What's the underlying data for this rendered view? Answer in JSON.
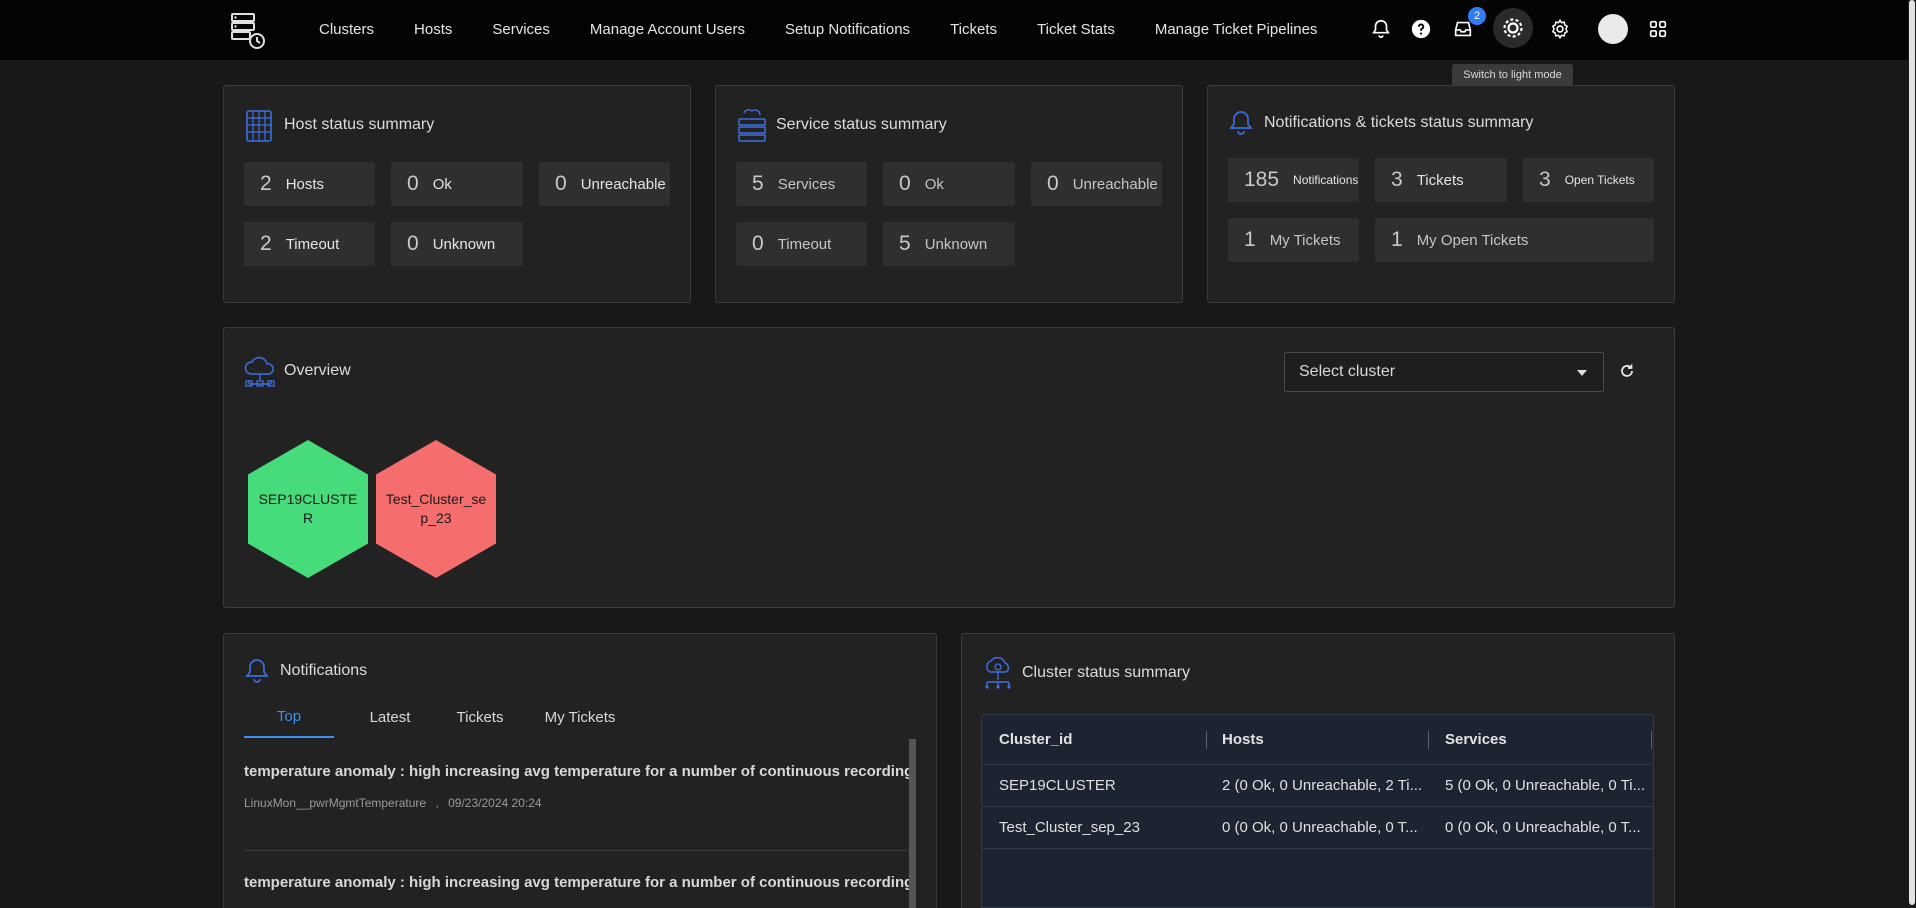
{
  "nav": {
    "items": [
      "Clusters",
      "Hosts",
      "Services",
      "Manage Account Users",
      "Setup Notifications",
      "Tickets",
      "Ticket Stats",
      "Manage Ticket Pipelines"
    ],
    "inbox_badge": "2",
    "tooltip": "Switch to light mode"
  },
  "host_summary": {
    "title": "Host status summary",
    "tiles": [
      {
        "num": "2",
        "label": "Hosts"
      },
      {
        "num": "0",
        "label": "Ok"
      },
      {
        "num": "0",
        "label": "Unreachable"
      },
      {
        "num": "2",
        "label": "Timeout"
      },
      {
        "num": "0",
        "label": "Unknown"
      }
    ]
  },
  "service_summary": {
    "title": "Service status summary",
    "tiles": [
      {
        "num": "5",
        "label": "Services"
      },
      {
        "num": "0",
        "label": "Ok"
      },
      {
        "num": "0",
        "label": "Unreachable"
      },
      {
        "num": "0",
        "label": "Timeout"
      },
      {
        "num": "5",
        "label": "Unknown"
      }
    ]
  },
  "notif_summary": {
    "title": "Notifications & tickets status summary",
    "tiles": [
      {
        "num": "185",
        "label": "Notifications"
      },
      {
        "num": "3",
        "label": "Tickets"
      },
      {
        "num": "3",
        "label": "Open Tickets"
      },
      {
        "num": "1",
        "label": "My Tickets"
      },
      {
        "num": "1",
        "label": "My Open Tickets"
      }
    ]
  },
  "overview": {
    "title": "Overview",
    "select_placeholder": "Select cluster",
    "clusters": [
      {
        "name": "SEP19CLUSTER",
        "color": "#46dc7b"
      },
      {
        "name": "Test_Cluster_sep_23",
        "color": "#f56d6d"
      }
    ]
  },
  "notifications": {
    "title": "Notifications",
    "tabs": [
      "Top",
      "Latest",
      "Tickets",
      "My Tickets"
    ],
    "items": [
      {
        "title": "temperature anomaly : high increasing avg temperature for a number of continuous recordings",
        "source": "LinuxMon__pwrMgmtTemperature",
        "time": "09/23/2024 20:24"
      },
      {
        "title": "temperature anomaly : high increasing avg temperature for a number of continuous recordings",
        "source": "",
        "time": ""
      }
    ]
  },
  "cluster_summary": {
    "title": "Cluster status summary",
    "columns": [
      "Cluster_id",
      "Hosts",
      "Services"
    ],
    "rows": [
      [
        "SEP19CLUSTER",
        "2 (0 Ok, 0 Unreachable, 2 Ti...",
        "5 (0 Ok, 0 Unreachable, 0 Ti..."
      ],
      [
        "Test_Cluster_sep_23",
        "0 (0 Ok, 0 Unreachable, 0 T...",
        "0 (0 Ok, 0 Unreachable, 0 T..."
      ]
    ]
  },
  "colors": {
    "accent": "#3d8ef7",
    "icon_blue": "#3c6ee0",
    "ok": "#46dc7b",
    "error": "#f56d6d"
  }
}
